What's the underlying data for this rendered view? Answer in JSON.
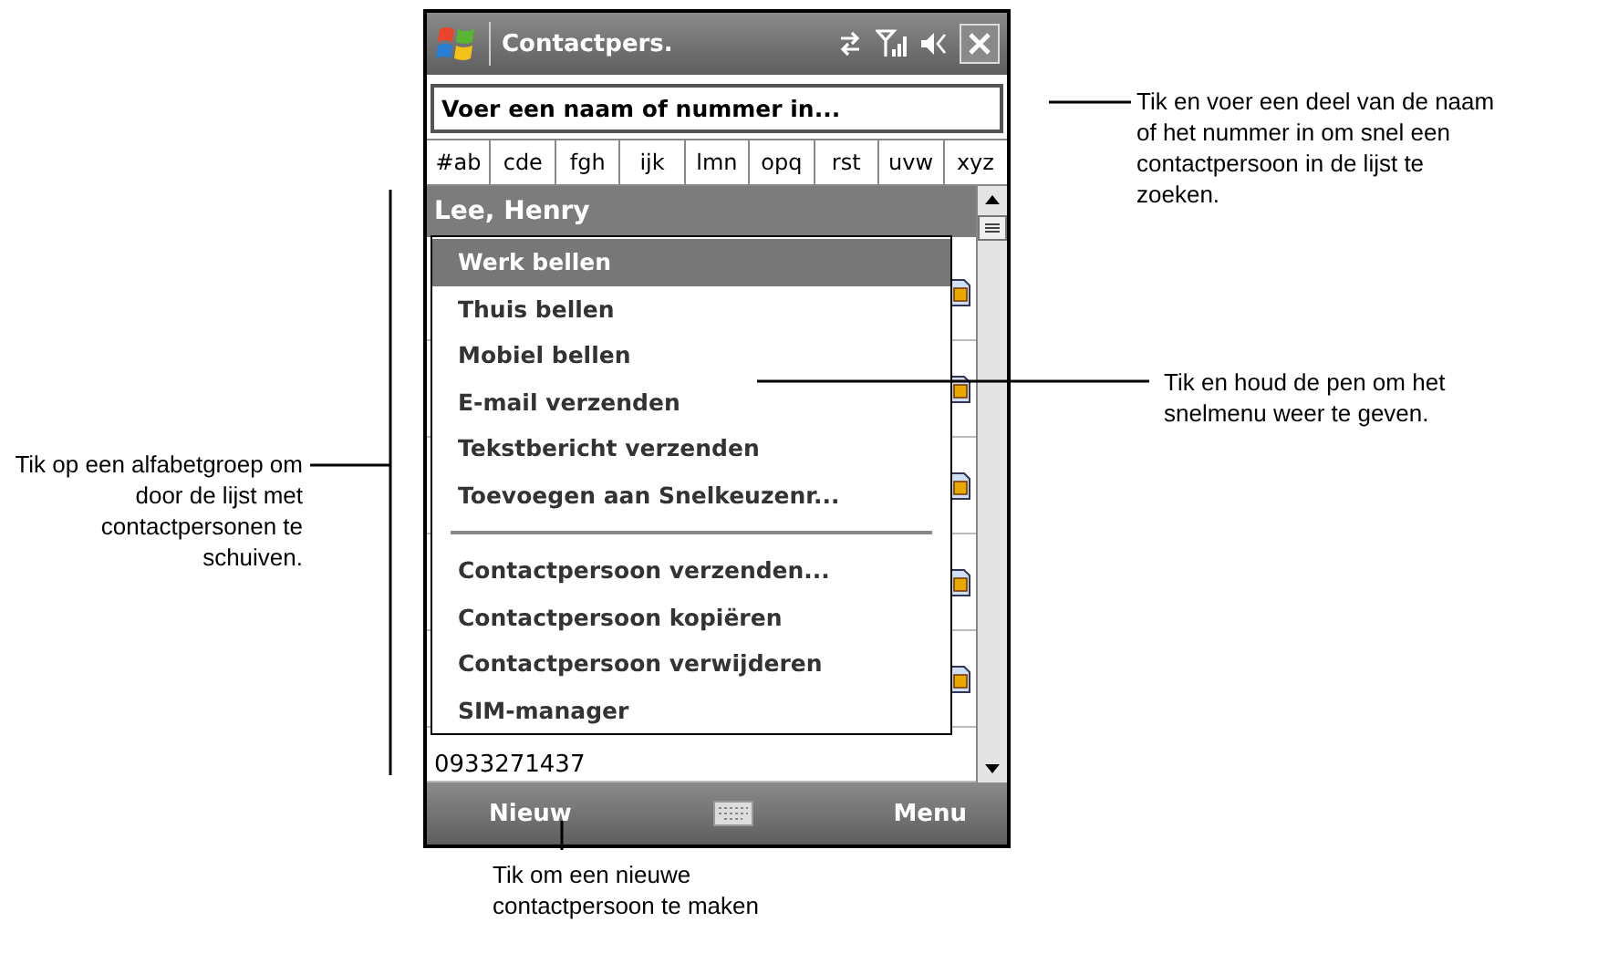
{
  "title_bar": {
    "title": "Contactpers."
  },
  "search": {
    "placeholder": "Voer een naam of nummer in..."
  },
  "alpha_groups": [
    "#ab",
    "cde",
    "fgh",
    "ijk",
    "lmn",
    "opq",
    "rst",
    "uvw",
    "xyz"
  ],
  "contact_header": "Lee, Henry",
  "partial_number": "0933271437",
  "context_menu": {
    "items": [
      {
        "kind": "item",
        "label": "Werk bellen",
        "selected": true
      },
      {
        "kind": "item",
        "label": "Thuis bellen",
        "selected": false
      },
      {
        "kind": "item",
        "label": "Mobiel bellen",
        "selected": false
      },
      {
        "kind": "item",
        "label": "E-mail verzenden",
        "selected": false
      },
      {
        "kind": "item",
        "label": "Tekstbericht verzenden",
        "selected": false
      },
      {
        "kind": "item",
        "label": "Toevoegen aan Snelkeuzenr...",
        "selected": false
      },
      {
        "kind": "separator"
      },
      {
        "kind": "item",
        "label": "Contactpersoon verzenden...",
        "selected": false
      },
      {
        "kind": "item",
        "label": "Contactpersoon kopiëren",
        "selected": false
      },
      {
        "kind": "item",
        "label": "Contactpersoon verwijderen",
        "selected": false
      },
      {
        "kind": "item",
        "label": "SIM-manager",
        "selected": false
      }
    ]
  },
  "soft_keys": {
    "left": "Nieuw",
    "right": "Menu"
  },
  "callouts": [
    {
      "text": "Tik en voer een deel van de naam of het nummer in om snel een contactpersoon in de lijst te zoeken."
    },
    {
      "text": "Tik en houd de pen om het snelmenu weer te geven."
    },
    {
      "text": "Tik op een alfabetgroep om door de lijst met contactpersonen te schuiven."
    },
    {
      "text": "Tik om een nieuwe contactpersoon te maken"
    }
  ]
}
